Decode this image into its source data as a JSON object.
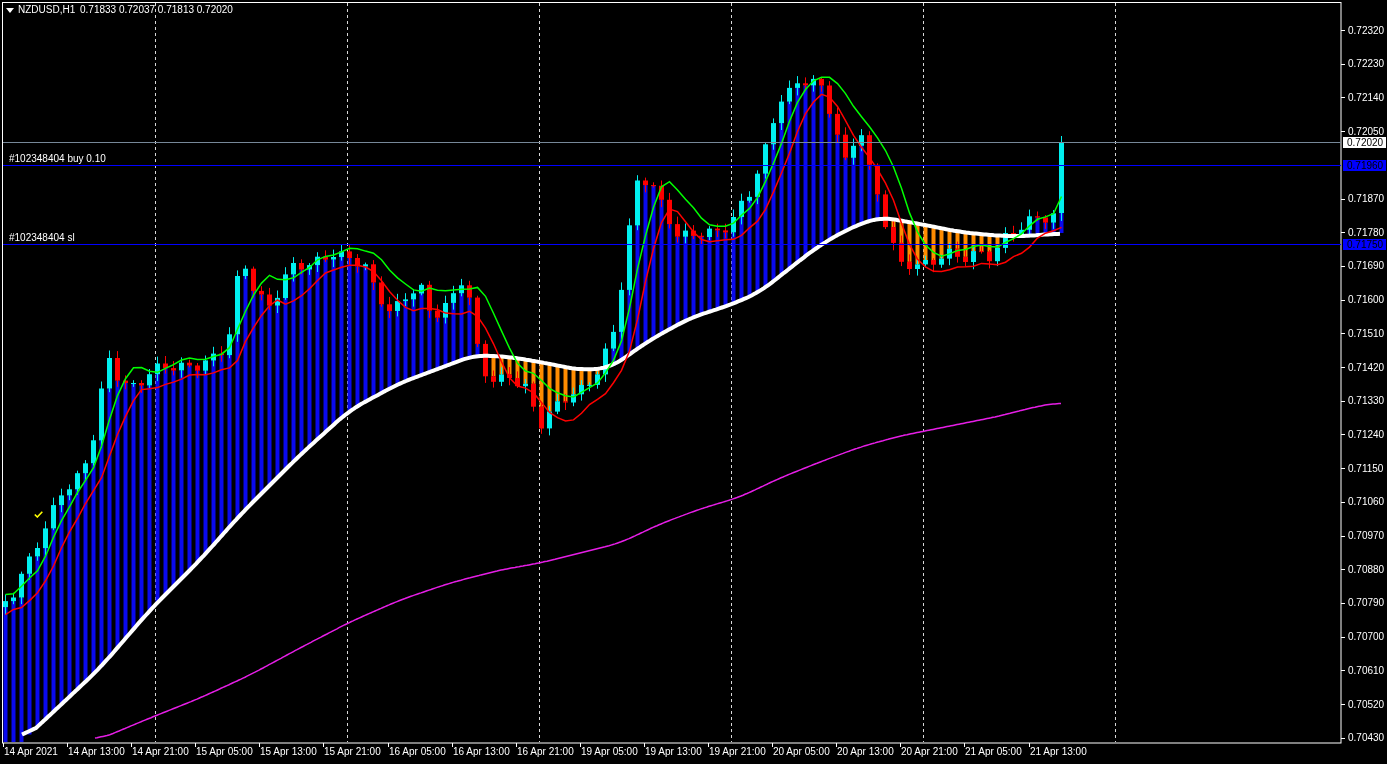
{
  "chart_title": {
    "symbol": "NZDUSD,H1",
    "ohlc": "0.71833 0.72037 0.71813 0.72020"
  },
  "price_lines": [
    {
      "kind": "bid",
      "tag": "0.72020"
    },
    {
      "kind": "order",
      "label": "#102348404 buy 0.10",
      "tag": "0.71960"
    },
    {
      "kind": "order",
      "label": "#102348404 sl",
      "tag": "0.71750"
    }
  ],
  "price_axis": {
    "labels": [
      "0.72320",
      "0.72230",
      "0.72140",
      "0.72050",
      "0.71870",
      "0.71780",
      "0.71690",
      "0.71600",
      "0.71510",
      "0.71420",
      "0.71330",
      "0.71240",
      "0.71150",
      "0.71060",
      "0.70970",
      "0.70880",
      "0.70790",
      "0.70700",
      "0.70610",
      "0.70520",
      "0.70430"
    ]
  },
  "time_axis": {
    "labels": [
      "14 Apr 2021",
      "14 Apr 13:00",
      "14 Apr 21:00",
      "15 Apr 05:00",
      "15 Apr 13:00",
      "15 Apr 21:00",
      "16 Apr 05:00",
      "16 Apr 13:00",
      "16 Apr 21:00",
      "19 Apr 05:00",
      "19 Apr 13:00",
      "19 Apr 21:00",
      "20 Apr 05:00",
      "20 Apr 13:00",
      "20 Apr 21:00",
      "21 Apr 05:00",
      "21 Apr 13:00"
    ]
  }
}
